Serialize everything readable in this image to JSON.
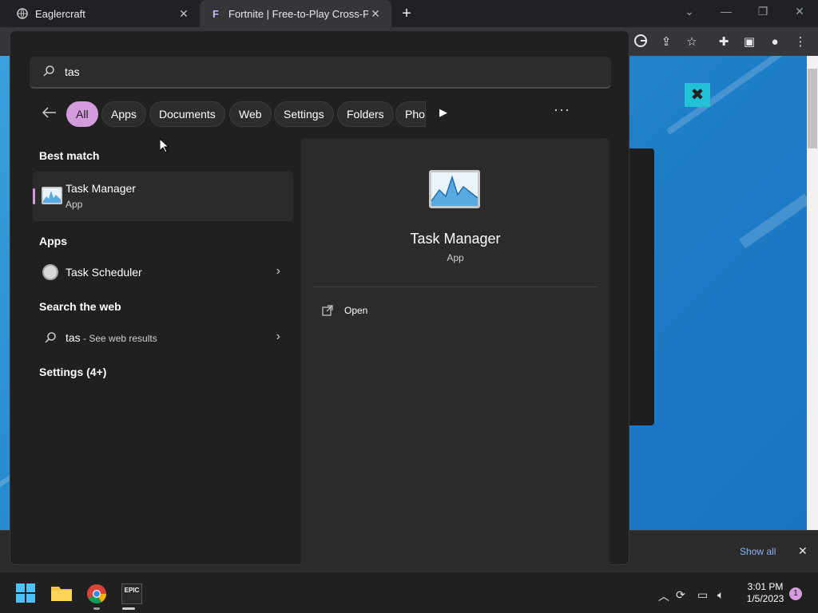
{
  "browser": {
    "tabs": [
      {
        "title": "Eaglercraft"
      },
      {
        "title": "Fortnite | Free-to-Play Cross-Platf"
      }
    ],
    "new_tab_label": "+",
    "download_bar": {
      "show_all": "Show all",
      "close": "✕"
    }
  },
  "search": {
    "query": "tas",
    "filters": [
      "All",
      "Apps",
      "Documents",
      "Web",
      "Settings",
      "Folders",
      "Phot"
    ],
    "more": "···",
    "best_match": {
      "heading": "Best match",
      "name": "Task Manager",
      "type": "App"
    },
    "apps": {
      "heading": "Apps",
      "items": [
        {
          "name": "Task Scheduler"
        }
      ]
    },
    "web": {
      "heading": "Search the web",
      "query": "tas",
      "suffix": " - See web results"
    },
    "settings": {
      "heading": "Settings (4+)"
    },
    "preview": {
      "title": "Task Manager",
      "type": "App",
      "actions": [
        {
          "label": "Open"
        }
      ]
    }
  },
  "taskbar": {
    "time": "3:01 PM",
    "date": "1/5/2023",
    "notifications": "1",
    "epic_label": "EPIC"
  },
  "colors": {
    "accent": "#d49cdc",
    "panel": "#202020",
    "link": "#8ab4f8"
  },
  "icons": [
    "globe-icon",
    "fortnite-icon",
    "google-icon",
    "share-icon",
    "star-icon",
    "extensions-icon",
    "sidebar-icon",
    "profile-icon",
    "menu-icon",
    "search-icon",
    "back-arrow-icon",
    "play-arrow-icon",
    "task-manager-icon",
    "task-scheduler-icon",
    "chevron-right-icon",
    "open-external-icon",
    "windows-start-icon",
    "file-explorer-icon",
    "chrome-icon",
    "epic-games-icon",
    "tray-chevron-icon",
    "sync-icon",
    "network-icon",
    "volume-icon"
  ]
}
